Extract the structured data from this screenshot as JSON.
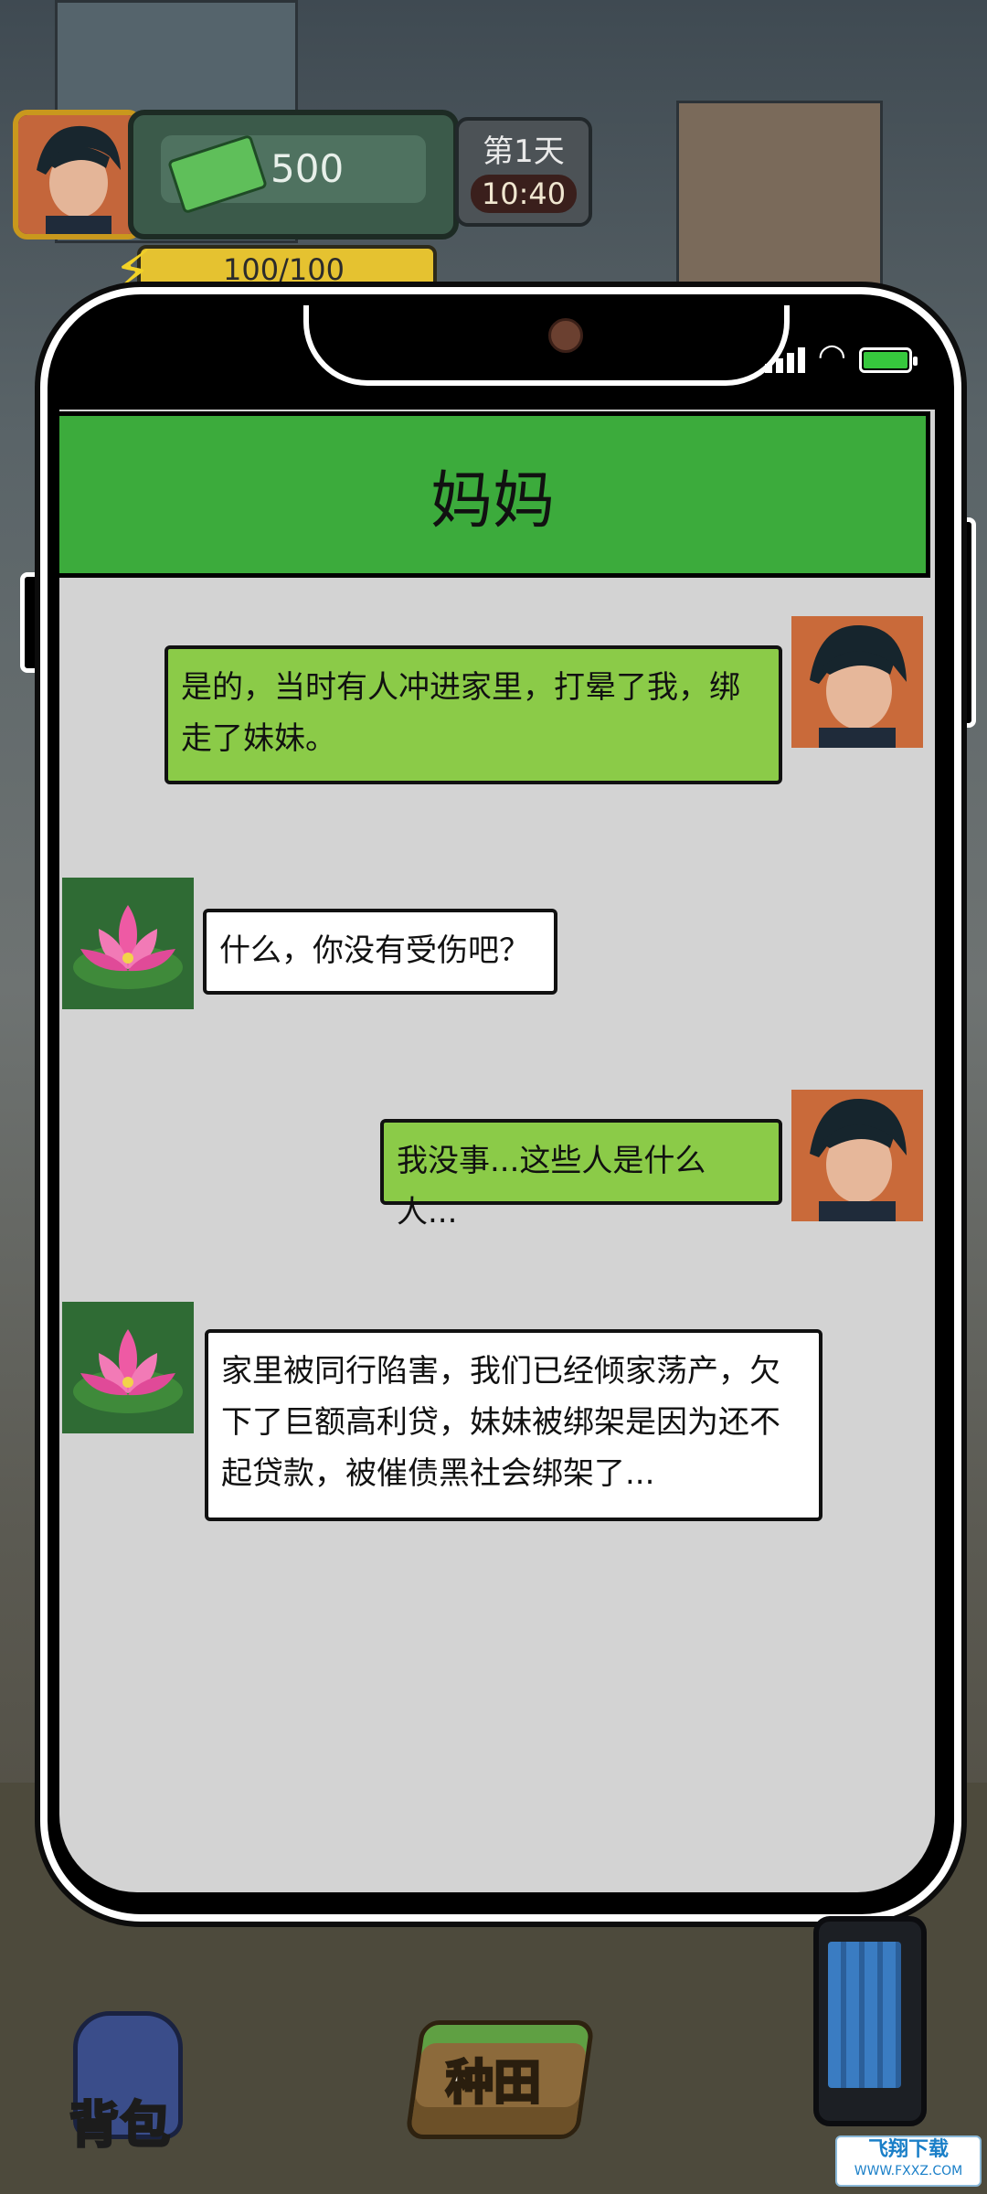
{
  "hud": {
    "money": "500",
    "day": "第1天",
    "time": "10:40",
    "energy": "100/100"
  },
  "phone": {
    "contact_name": "妈妈",
    "messages": [
      {
        "sender": "me",
        "text": "是的，当时有人冲进家里，打晕了我，绑走了妹妹。"
      },
      {
        "sender": "them",
        "text": "什么，你没有受伤吧？"
      },
      {
        "sender": "me",
        "text": "我没事...这些人是什么人..."
      },
      {
        "sender": "them",
        "text": "家里被同行陷害，我们已经倾家荡产，欠下了巨额高利贷，妹妹被绑架是因为还不起贷款，被催债黑社会绑架了..."
      }
    ]
  },
  "bottom_bar": {
    "bag_label": "背包",
    "farm_label": "种田"
  },
  "watermark": {
    "main": "飞翔下载",
    "sub": "WWW.FXXZ.COM"
  },
  "colors": {
    "header_green": "#3cab3c",
    "my_bubble": "#8bcb48",
    "their_bubble": "#ffffff",
    "chat_bg": "#d3d3d3"
  }
}
